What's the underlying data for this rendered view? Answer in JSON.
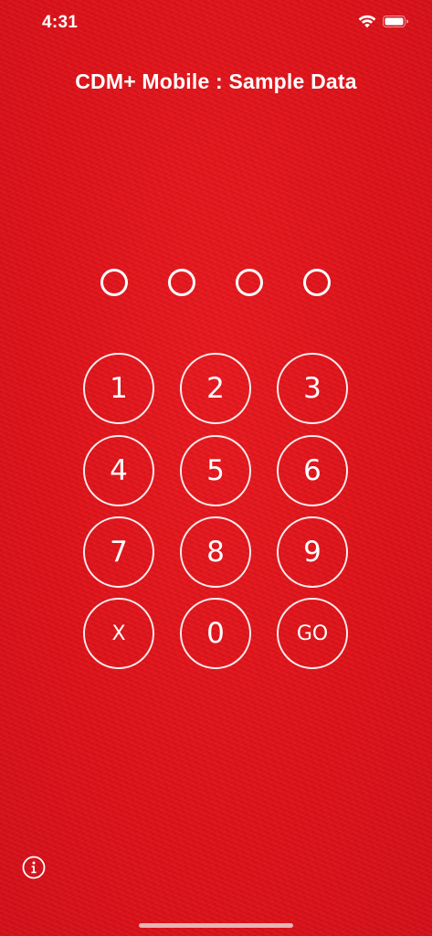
{
  "status_bar": {
    "time": "4:31",
    "wifi_icon": "wifi-icon",
    "battery_icon": "battery-icon"
  },
  "title": "CDM+ Mobile : Sample Data",
  "pin": {
    "length": 4,
    "filled": 0
  },
  "keypad": {
    "key_1": "1",
    "key_2": "2",
    "key_3": "3",
    "key_4": "4",
    "key_5": "5",
    "key_6": "6",
    "key_7": "7",
    "key_8": "8",
    "key_9": "9",
    "key_clear": "X",
    "key_0": "0",
    "key_go": "GO"
  },
  "info_icon": "info-icon",
  "colors": {
    "background": "#e1141c",
    "foreground": "#ffffff"
  }
}
